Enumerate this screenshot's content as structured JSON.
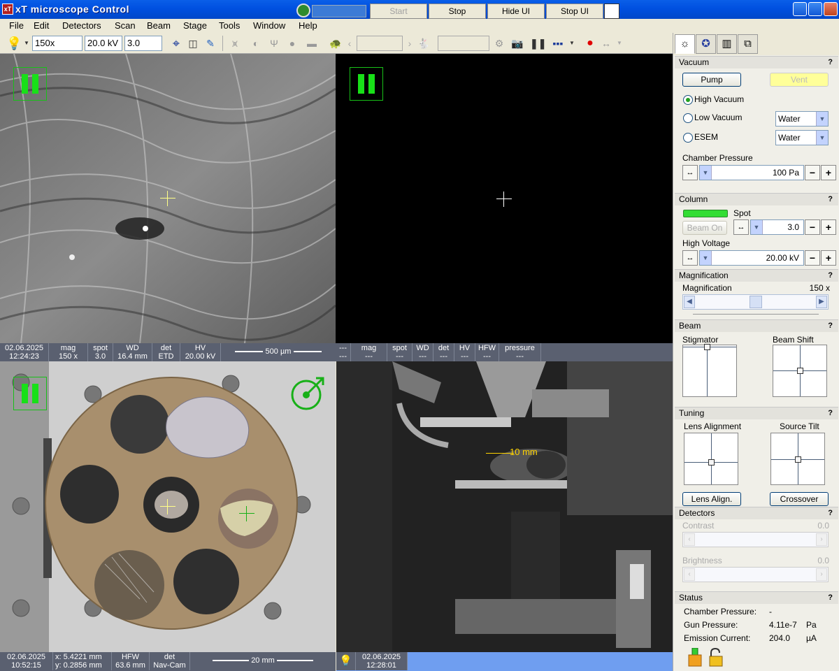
{
  "window": {
    "title": "xT microscope Control",
    "buttons": {
      "start": "Start",
      "stop": "Stop",
      "hide_ui": "Hide UI",
      "stop_ui": "Stop UI"
    }
  },
  "menu": [
    "File",
    "Edit",
    "Detectors",
    "Scan",
    "Beam",
    "Stage",
    "Tools",
    "Window",
    "Help"
  ],
  "toolbar": {
    "magnification": "150x",
    "voltage": "20.0 kV",
    "spot": "3.0"
  },
  "quad1": {
    "date": "02.06.2025",
    "time": "12:24:23",
    "mag_label": "mag",
    "mag": "150 x",
    "spot_label": "spot",
    "spot": "3.0",
    "wd_label": "WD",
    "wd": "16.4 mm",
    "det_label": "det",
    "det": "ETD",
    "hv_label": "HV",
    "hv": "20.00 kV",
    "scale": "500 µm"
  },
  "quad2": {
    "c0a": "---",
    "c0b": "---",
    "mag_label": "mag",
    "mag": "---",
    "spot_label": "spot",
    "spot": "---",
    "wd_label": "WD",
    "wd": "---",
    "det_label": "det",
    "det": "---",
    "hv_label": "HV",
    "hv": "---",
    "hfw_label": "HFW",
    "hfw": "---",
    "pressure_label": "pressure",
    "pressure": "---"
  },
  "quad3": {
    "date": "02.06.2025",
    "time": "10:52:15",
    "x": "x: 5.4221 mm",
    "y": "y: 0.2856 mm",
    "hfw_label": "HFW",
    "hfw": "63.6 mm",
    "det_label": "det",
    "det": "Nav-Cam",
    "scale": "20 mm"
  },
  "quad4": {
    "date": "02.06.2025",
    "time": "12:28:01",
    "measure": "10 mm"
  },
  "panel": {
    "vacuum": {
      "title": "Vacuum",
      "help": "?",
      "pump": "Pump",
      "vent": "Vent",
      "high": "High Vacuum",
      "low": "Low Vacuum",
      "esem": "ESEM",
      "low_gas": "Water",
      "esem_gas": "Water",
      "pressure_label": "Chamber Pressure",
      "pressure": "100 Pa"
    },
    "column": {
      "title": "Column",
      "help": "?",
      "spot_label": "Spot",
      "spot": "3.0",
      "beam_on": "Beam On",
      "hv_label": "High Voltage",
      "hv": "20.00 kV"
    },
    "magnification": {
      "title": "Magnification",
      "help": "?",
      "label": "Magnification",
      "value": "150 x",
      "slider_level": 0.5
    },
    "beam": {
      "title": "Beam",
      "help": "?",
      "stigmator": "Stigmator",
      "shift": "Beam Shift"
    },
    "tuning": {
      "title": "Tuning",
      "help": "?",
      "lens": "Lens Alignment",
      "source": "Source Tilt",
      "lens_btn": "Lens Align.",
      "crossover": "Crossover"
    },
    "detectors": {
      "title": "Detectors",
      "help": "?",
      "contrast": "Contrast",
      "contrast_val": "0.0",
      "brightness": "Brightness",
      "brightness_val": "0.0"
    },
    "status": {
      "title": "Status",
      "help": "?",
      "chamber_label": "Chamber Pressure:",
      "chamber": "-",
      "gun_label": "Gun Pressure:",
      "gun": "4.11e-7",
      "gun_unit": "Pa",
      "emission_label": "Emission Current:",
      "emission": "204.0",
      "emission_unit": "µA"
    }
  },
  "colors": {
    "titlebar": "#0050e0",
    "pause": "#18e018",
    "crosshair": "#ffff88",
    "vent": "#ffff99",
    "beam_indicator": "#33dd33"
  }
}
